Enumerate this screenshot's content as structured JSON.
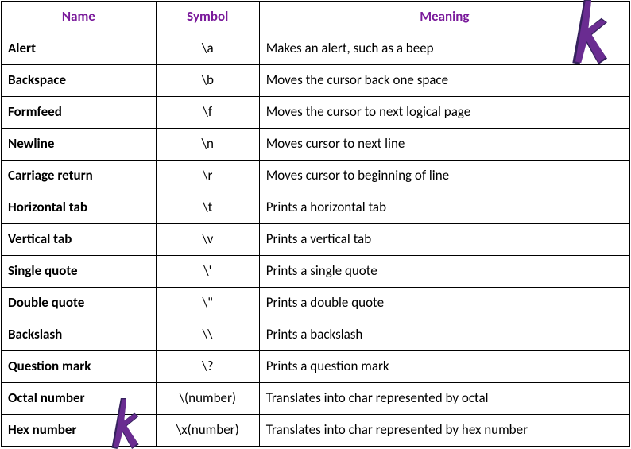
{
  "table": {
    "headers": {
      "name": "Name",
      "symbol": "Symbol",
      "meaning": "Meaning"
    },
    "rows": [
      {
        "name": "Alert",
        "symbol": "\\a",
        "meaning": "Makes an alert, such as a beep"
      },
      {
        "name": "Backspace",
        "symbol": "\\b",
        "meaning": "Moves the cursor back one space"
      },
      {
        "name": "Formfeed",
        "symbol": "\\f",
        "meaning": "Moves the cursor to next logical page"
      },
      {
        "name": "Newline",
        "symbol": "\\n",
        "meaning": "Moves cursor to next line"
      },
      {
        "name": "Carriage return",
        "symbol": "\\r",
        "meaning": "Moves cursor to beginning of line"
      },
      {
        "name": "Horizontal tab",
        "symbol": "\\t",
        "meaning": "Prints a horizontal tab"
      },
      {
        "name": "Vertical tab",
        "symbol": "\\v",
        "meaning": "Prints a vertical tab"
      },
      {
        "name": "Single quote",
        "symbol": "\\'",
        "meaning": "Prints a single quote"
      },
      {
        "name": "Double quote",
        "symbol": "\\\"",
        "meaning": "Prints a double quote"
      },
      {
        "name": "Backslash",
        "symbol": "\\\\",
        "meaning": "Prints a backslash"
      },
      {
        "name": "Question mark",
        "symbol": "\\?",
        "meaning": "Prints a question mark"
      },
      {
        "name": "Octal number",
        "symbol": "\\(number)",
        "meaning": "Translates into char represented by octal"
      },
      {
        "name": "Hex number",
        "symbol": "\\x(number)",
        "meaning": "Translates into char represented by hex number"
      }
    ]
  },
  "colors": {
    "header_text": "#7a1a9b",
    "border": "#000000",
    "logo1": "#36225e",
    "logo2": "#6a2c91"
  }
}
